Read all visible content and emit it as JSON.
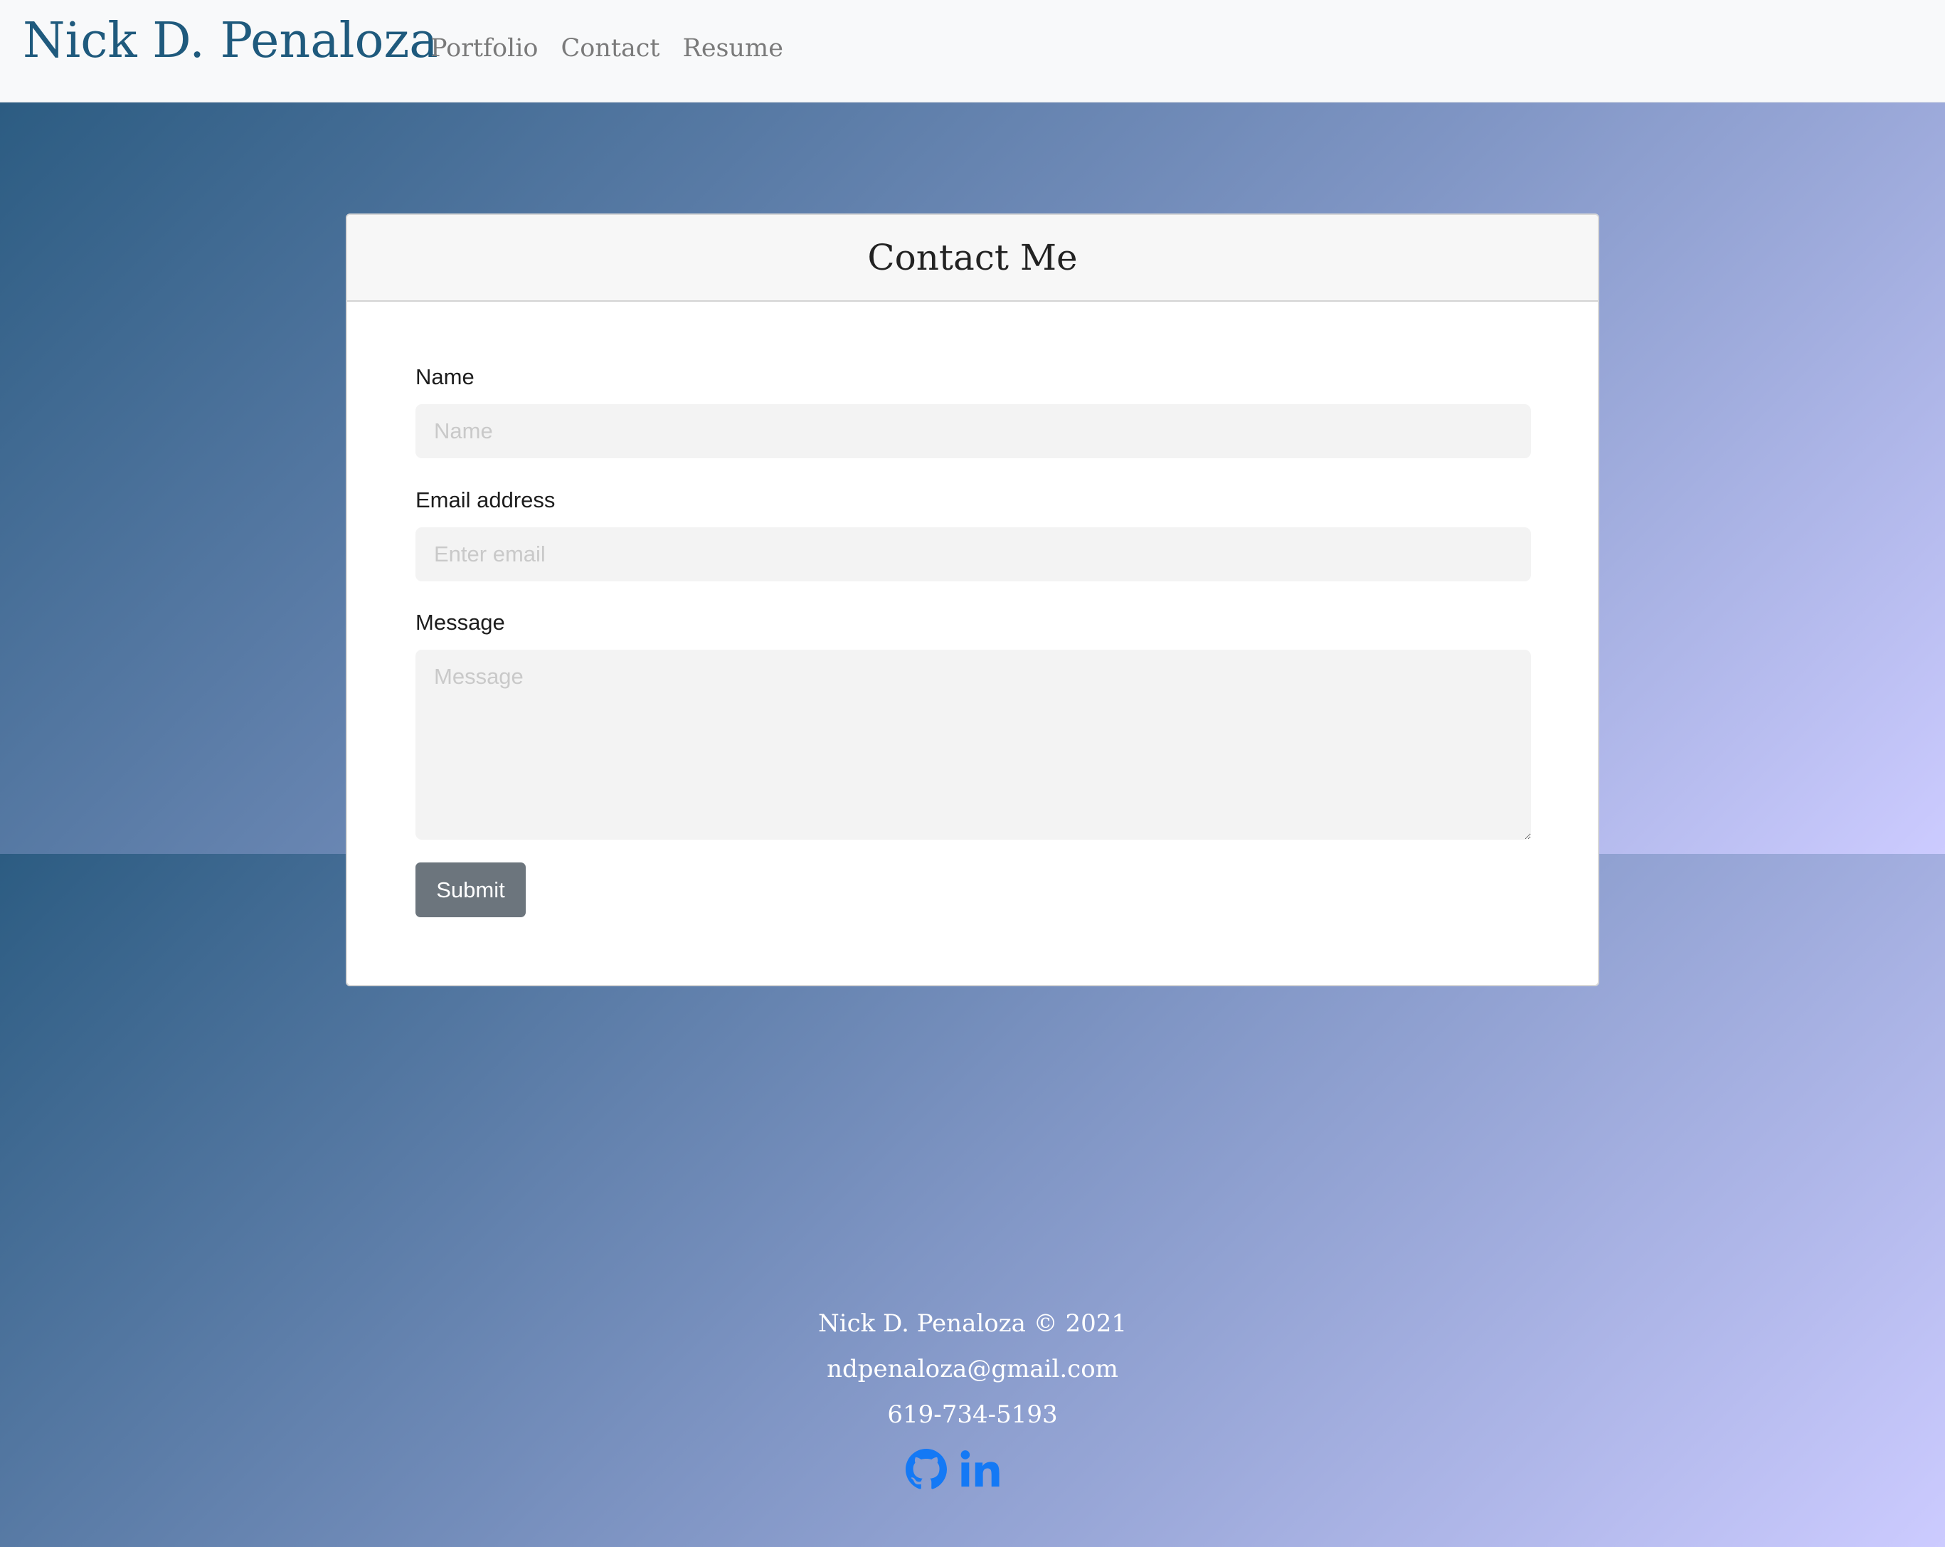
{
  "navbar": {
    "brand": "Nick D. Penaloza",
    "links": [
      "Portfolio",
      "Contact",
      "Resume"
    ]
  },
  "contact_form": {
    "title": "Contact Me",
    "name_label": "Name",
    "name_placeholder": "Name",
    "email_label": "Email address",
    "email_placeholder": "Enter email",
    "message_label": "Message",
    "message_placeholder": "Message",
    "submit_label": "Submit"
  },
  "footer": {
    "copyright": "Nick D. Penaloza © 2021",
    "email": "ndpenaloza@gmail.com",
    "phone": "619-734-5193",
    "social_icons": [
      "github-icon",
      "linkedin-icon"
    ]
  },
  "colors": {
    "brand": "#1f5a7d",
    "nav_link": "#7a7a7a",
    "button": "#6c757d",
    "social_icon": "#1479f5",
    "gradient_start": "#2c5c82",
    "gradient_end": "#cccbff"
  }
}
